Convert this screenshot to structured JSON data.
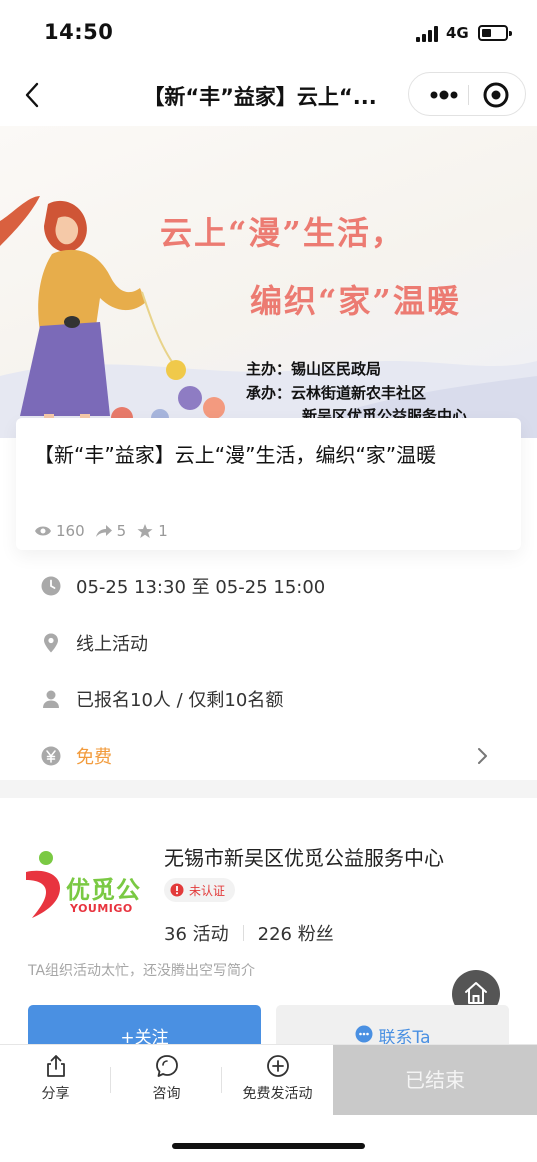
{
  "status_bar": {
    "time": "14:50",
    "network": "4G"
  },
  "nav": {
    "title": "【新“丰”益家】云上“..."
  },
  "banner": {
    "slogan_line1": "云上“漫”生活，",
    "slogan_line2": "编织“家”温暖",
    "host": "主办：锡山区民政局",
    "organizer": "承办：云林街道新农丰社区",
    "organizer_2": "新吴区优觅公益服务中心"
  },
  "event": {
    "title": "【新“丰”益家】云上“漫”生活，编织“家”温暖",
    "views": "160",
    "shares": "5",
    "favorites": "1"
  },
  "info": {
    "time": "05-25 13:30 至 05-25 15:00",
    "location": "线上活动",
    "signup": "已报名10人 / 仅剩10名额",
    "price": "免费"
  },
  "organizer": {
    "logo_text": "优觅公",
    "logo_sub": "YOUMIGO",
    "name": "无锡市新吴区优觅公益服务中心",
    "badge": "未认证",
    "activities": "36 活动",
    "fans": "226 粉丝",
    "intro": "TA组织活动太忙，还没腾出空写简介",
    "follow_label": "+关注",
    "contact_label": "联系Ta"
  },
  "bottom_bar": {
    "share": "分享",
    "consult": "咨询",
    "publish": "免费发活动",
    "ended": "已结束"
  },
  "colors": {
    "accent_blue": "#4a90e2",
    "price_orange": "#f29b3c",
    "badge_red": "#e23a3a",
    "slogan_pink": "#ec7b72"
  }
}
